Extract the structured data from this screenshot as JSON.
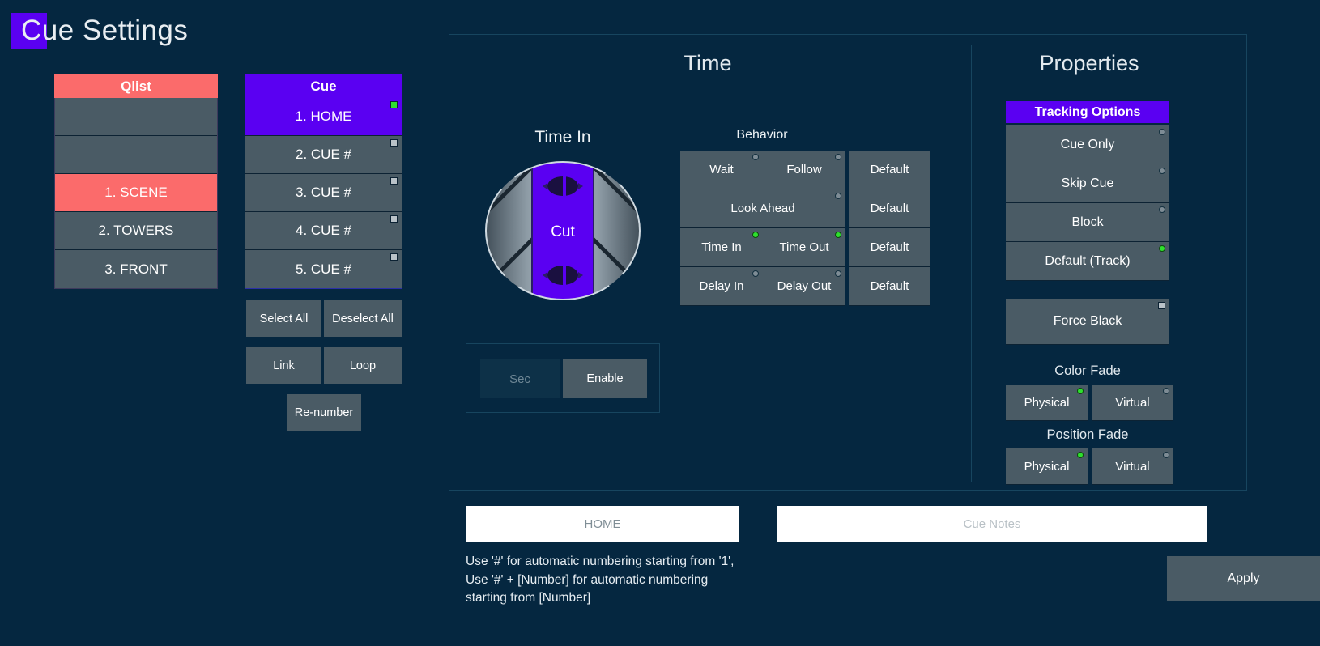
{
  "app": {
    "title": "Cue Settings",
    "background_color": "#052740",
    "accent_purple": "#5a00f2",
    "accent_red": "#fb6b6b",
    "button_gray": "#4a5b65",
    "led_on_color": "#2ee02e"
  },
  "qlist": {
    "header": "Qlist",
    "items": [
      {
        "label": "",
        "selected": false
      },
      {
        "label": "",
        "selected": false
      },
      {
        "label": "1. SCENE",
        "selected": true
      },
      {
        "label": "2. TOWERS",
        "selected": false
      },
      {
        "label": "3. FRONT",
        "selected": false
      }
    ]
  },
  "cuelist": {
    "header": "Cue",
    "items": [
      {
        "label": "1. HOME",
        "selected": true,
        "checked": true
      },
      {
        "label": "2. CUE #",
        "selected": false,
        "checked": false
      },
      {
        "label": "3. CUE #",
        "selected": false,
        "checked": false
      },
      {
        "label": "4. CUE #",
        "selected": false,
        "checked": false
      },
      {
        "label": "5. CUE #",
        "selected": false,
        "checked": false
      }
    ],
    "buttons": {
      "select_all": "Select All",
      "deselect_all": "Deselect All",
      "link": "Link",
      "loop": "Loop",
      "renumber": "Re-number"
    }
  },
  "time": {
    "section_title": "Time",
    "dial_label": "Time In",
    "dial_value": "Cut",
    "behavior_label": "Behavior",
    "rows": [
      {
        "cells": [
          {
            "label": "Wait",
            "led": false
          },
          {
            "label": "Follow",
            "led": false
          }
        ],
        "default": "Default"
      },
      {
        "cells": [
          {
            "label": "Look Ahead",
            "led": false
          }
        ],
        "default": "Default"
      },
      {
        "cells": [
          {
            "label": "Time In",
            "led": true
          },
          {
            "label": "Time Out",
            "led": true
          }
        ],
        "default": "Default"
      },
      {
        "cells": [
          {
            "label": "Delay In",
            "led": false
          },
          {
            "label": "Delay Out",
            "led": false
          }
        ],
        "default": "Default"
      }
    ],
    "sec_placeholder": "Sec",
    "sec_value": "",
    "enable_label": "Enable",
    "enable_checked": false
  },
  "properties": {
    "section_title": "Properties",
    "tracking_header": "Tracking Options",
    "tracking_options": [
      {
        "label": "Cue Only",
        "led": false
      },
      {
        "label": "Skip Cue",
        "led": false
      },
      {
        "label": "Block",
        "led": false
      },
      {
        "label": "Default (Track)",
        "led": true
      }
    ],
    "force_black": {
      "label": "Force Black",
      "checked": false
    },
    "color_fade": {
      "label": "Color Fade",
      "options": [
        {
          "label": "Physical",
          "led": true
        },
        {
          "label": "Virtual",
          "led": false
        }
      ]
    },
    "position_fade": {
      "label": "Position Fade",
      "options": [
        {
          "label": "Physical",
          "led": true
        },
        {
          "label": "Virtual",
          "led": false
        }
      ]
    }
  },
  "bottom": {
    "name_value": "HOME",
    "name_placeholder": "",
    "notes_value": "",
    "notes_placeholder": "Cue Notes",
    "hint": "Use '#' for automatic numbering starting from '1', Use '#' + [Number] for automatic numbering starting from [Number]",
    "apply_label": "Apply"
  }
}
